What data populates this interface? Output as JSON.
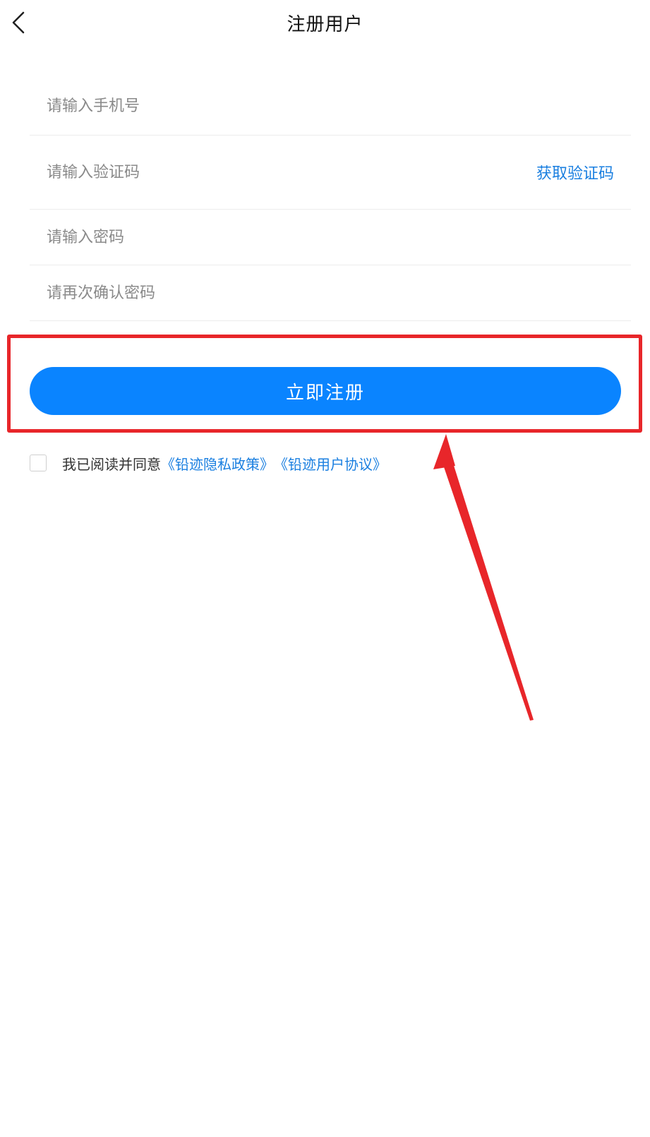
{
  "header": {
    "title": "注册用户",
    "back_icon": "chevron-left-icon"
  },
  "form": {
    "phone": {
      "placeholder": "请输入手机号",
      "value": ""
    },
    "code": {
      "placeholder": "请输入验证码",
      "value": "",
      "action_label": "获取验证码"
    },
    "password": {
      "placeholder": "请输入密码",
      "value": ""
    },
    "confirm_password": {
      "placeholder": "请再次确认密码",
      "value": ""
    }
  },
  "register_button": {
    "label": "立即注册"
  },
  "agreement": {
    "checked": false,
    "text": "我已阅读并同意",
    "privacy_link": "《铅迹隐私政策》",
    "user_link": "《铅迹用户协议》"
  },
  "colors": {
    "accent": "#0a84ff",
    "link": "#1a7fe0",
    "annotation": "#e8262a"
  }
}
